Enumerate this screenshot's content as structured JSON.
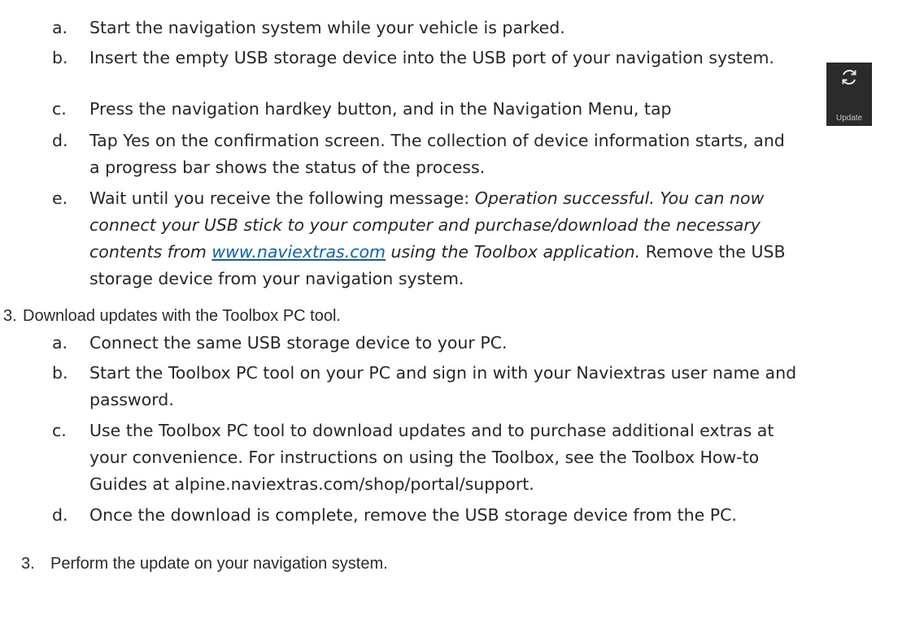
{
  "list1": {
    "a": {
      "marker": "a.",
      "text": "Start the navigation system while your vehicle is parked."
    },
    "b": {
      "marker": "b.",
      "text": "Insert the empty USB storage device into the USB port of your navigation system."
    },
    "c": {
      "marker": "c.",
      "text": "Press the navigation hardkey button, and in the Navigation Menu, tap"
    },
    "update_button": {
      "label": "Update",
      "icon": "refresh-icon"
    },
    "d": {
      "marker": "d.",
      "line1": "Tap Yes on the confirmation screen. The collection of device information starts, and",
      "line2": "a progress bar shows the status of the process."
    },
    "e": {
      "marker": "e.",
      "lead": "Wait until you receive the following message: ",
      "msg1": "Operation successful. You can now",
      "msg2": "connect your USB stick to your computer and purchase/download the necessary",
      "msg3": "contents from ",
      "link": "www.naviextras.com",
      "msg4": " using the Toolbox application.",
      "tail1": " Remove the USB",
      "tail2": "storage device from your navigation system."
    }
  },
  "step_download": {
    "number": "3.",
    "text": "Download updates with the Toolbox PC tool."
  },
  "list2": {
    "a": {
      "marker": "a.",
      "text": "Connect the same USB storage device to your PC."
    },
    "b": {
      "marker": "b.",
      "line1": "Start the Toolbox PC tool on your PC and sign in with your Naviextras user name and",
      "line2": "password."
    },
    "c": {
      "marker": "c.",
      "line1": "Use the Toolbox PC tool to download updates and to purchase additional extras at",
      "line2": "your convenience. For instructions on using the Toolbox, see the Toolbox How-to",
      "line3": "Guides at alpine.naviextras.com/shop/portal/support."
    },
    "d": {
      "marker": "d.",
      "text": "Once the download is complete, remove the USB storage device from the PC."
    }
  },
  "step_perform": {
    "number": "3.",
    "text": "Perform the update on your navigation system."
  }
}
